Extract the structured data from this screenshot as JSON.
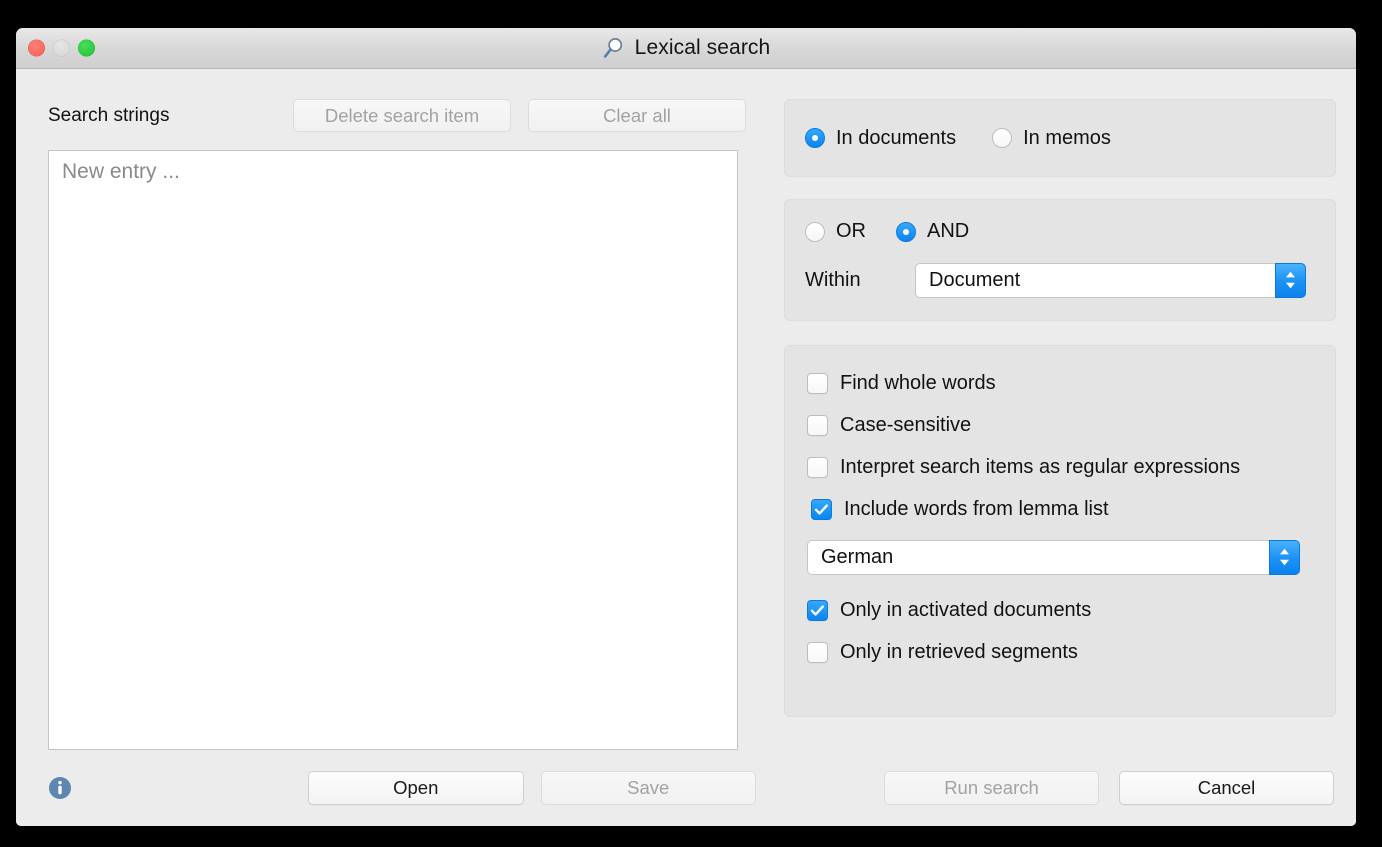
{
  "window": {
    "title": "Lexical search",
    "title_icon": "magnifier-icon",
    "traffic_lights": [
      {
        "name": "close",
        "color": "#f95d52",
        "enabled": true
      },
      {
        "name": "minimize",
        "color": "#d6d6d6",
        "enabled": false
      },
      {
        "name": "zoom",
        "color": "#1dc431",
        "enabled": true
      }
    ]
  },
  "left_panel": {
    "section_label": "Search strings",
    "delete_search_item": {
      "label": "Delete search item",
      "enabled": false
    },
    "clear_all": {
      "label": "Clear all",
      "enabled": false
    },
    "list_placeholder": "New entry ...",
    "info_icon": "info-icon",
    "open_button": {
      "label": "Open",
      "enabled": true
    },
    "save_button": {
      "label": "Save",
      "enabled": false
    }
  },
  "right_panel": {
    "scope": {
      "options": [
        {
          "label": "In documents",
          "selected": true
        },
        {
          "label": "In memos",
          "selected": false
        }
      ]
    },
    "operator": {
      "options": [
        {
          "label": "OR",
          "selected": false
        },
        {
          "label": "AND",
          "selected": true
        }
      ],
      "within_label": "Within",
      "within_value": "Document"
    },
    "options": {
      "find_whole_words": {
        "label": "Find whole words",
        "checked": false
      },
      "case_sensitive": {
        "label": "Case-sensitive",
        "checked": false
      },
      "regex": {
        "label": "Interpret search items as regular expressions",
        "checked": false
      },
      "lemma_list": {
        "label": "Include words from lemma list",
        "checked": true
      },
      "lemma_language": "German",
      "only_activated": {
        "label": "Only in activated documents",
        "checked": true
      },
      "only_retrieved": {
        "label": "Only in retrieved segments",
        "checked": false
      }
    },
    "run_search": {
      "label": "Run search",
      "enabled": false
    },
    "cancel": {
      "label": "Cancel",
      "enabled": true
    }
  },
  "colors": {
    "accent_blue": "#0a84f0",
    "window_bg": "#ececec",
    "group_bg": "#e4e4e4",
    "info_blue": "#4a7ba7"
  }
}
